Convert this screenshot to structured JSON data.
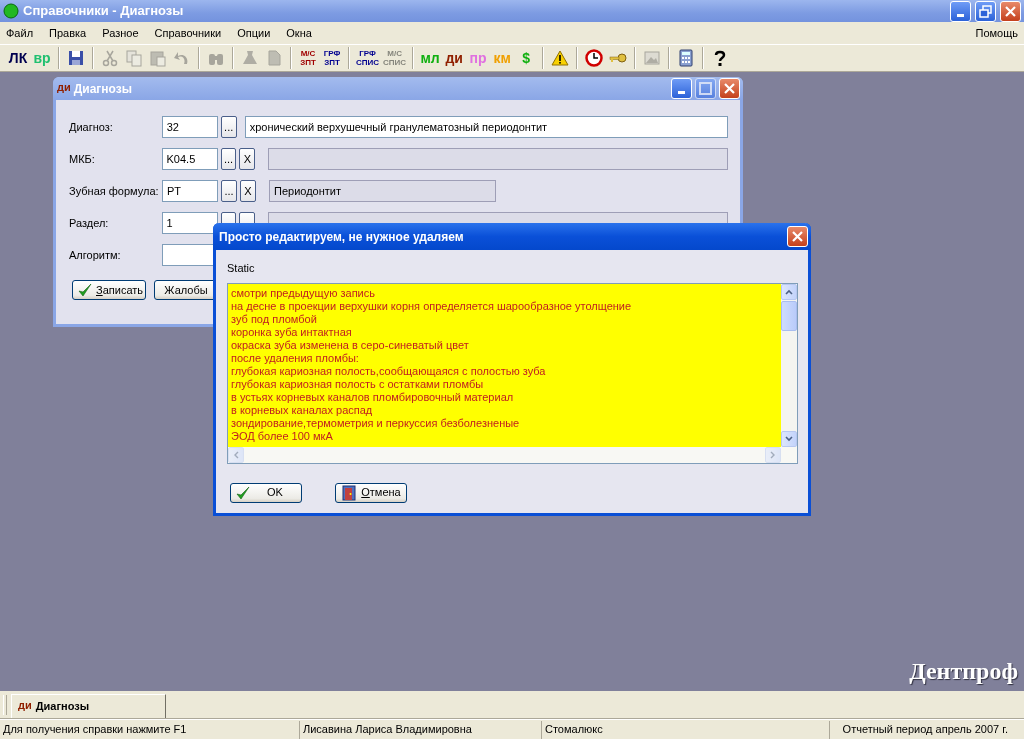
{
  "window": {
    "title": "Справочники - Диагнозы"
  },
  "menu": [
    "Файл",
    "Правка",
    "Разное",
    "Справочники",
    "Опции",
    "Окна"
  ],
  "help_menu": "Помощь",
  "toolbar": [
    {
      "kind": "text",
      "lines": [
        "ЛК"
      ],
      "color": "#000050",
      "disabled": false
    },
    {
      "kind": "text",
      "lines": [
        "вр"
      ],
      "color": "#20c070",
      "disabled": false
    },
    {
      "kind": "separator"
    },
    {
      "kind": "icon",
      "disabled": false
    },
    {
      "kind": "separator"
    },
    {
      "kind": "icon",
      "disabled": true
    },
    {
      "kind": "icon",
      "disabled": true
    },
    {
      "kind": "icon",
      "disabled": true
    },
    {
      "kind": "icon",
      "disabled": true
    },
    {
      "kind": "separator"
    },
    {
      "kind": "icon",
      "disabled": true
    },
    {
      "kind": "separator"
    },
    {
      "kind": "icon",
      "disabled": true
    },
    {
      "kind": "icon",
      "disabled": true
    },
    {
      "kind": "separator"
    },
    {
      "kind": "text",
      "lines": [
        "М/С",
        "ЗПТ"
      ],
      "color": "#a00000",
      "disabled": false
    },
    {
      "kind": "text",
      "lines": [
        "ГРФ",
        "ЗПТ"
      ],
      "color": "#000090",
      "disabled": false
    },
    {
      "kind": "separator"
    },
    {
      "kind": "text",
      "lines": [
        "ГРФ",
        "СПИС"
      ],
      "color": "#000090",
      "disabled": false
    },
    {
      "kind": "text",
      "lines": [
        "М/С",
        "СПИС"
      ],
      "disabled": true
    },
    {
      "kind": "separator"
    },
    {
      "kind": "text",
      "lines": [
        "мл"
      ],
      "color": "#10b010",
      "disabled": false
    },
    {
      "kind": "text",
      "lines": [
        "ди"
      ],
      "color": "#902000",
      "disabled": false
    },
    {
      "kind": "text",
      "lines": [
        "пр"
      ],
      "color": "#e070e0",
      "disabled": false
    },
    {
      "kind": "text",
      "lines": [
        "км"
      ],
      "color": "#f0a000",
      "disabled": false
    },
    {
      "kind": "text",
      "lines": [
        "$"
      ],
      "color": "#10b010",
      "disabled": false
    },
    {
      "kind": "separator"
    },
    {
      "kind": "icon",
      "disabled": false
    },
    {
      "kind": "separator"
    },
    {
      "kind": "icon",
      "disabled": false
    },
    {
      "kind": "icon",
      "disabled": false
    },
    {
      "kind": "separator"
    },
    {
      "kind": "icon",
      "disabled": true
    },
    {
      "kind": "separator"
    },
    {
      "kind": "icon",
      "disabled": false
    },
    {
      "kind": "separator"
    },
    {
      "kind": "icon",
      "disabled": false
    }
  ],
  "child_window": {
    "badge": "ди",
    "title": "Диагнозы",
    "fields": [
      {
        "kind": "code",
        "label": "Диагноз:",
        "code": "32",
        "browse": "...",
        "description": "хронический верхушечный гранулематозный периодонтит",
        "editable": true,
        "wide": true
      },
      {
        "kind": "code",
        "label": "МКБ:",
        "code": "K04.5",
        "browse": "...",
        "clear": "X",
        "editable": false,
        "wide": true
      },
      {
        "kind": "code",
        "label": "Зубная формула:",
        "code": "PT",
        "browse": "...",
        "clear": "X",
        "description": "Периодонтит",
        "editable": false,
        "wide": false
      },
      {
        "kind": "covered",
        "label": "Раздел:",
        "code": "1"
      },
      {
        "kind": "text",
        "label": "Алгоритм:"
      }
    ],
    "buttons": [
      {
        "kind": "confirm",
        "label": "Записать",
        "mnemonic": true
      },
      {
        "kind": "plain",
        "label": "Жалобы",
        "mnemonic": false
      }
    ]
  },
  "dialog": {
    "title": "Просто редактируем, не нужное удаляем",
    "label": "Static",
    "lines": [
      "смотри предыдущую запись",
      "на десне в проекции верхушки корня определяется шарообразное утолщение",
      "зуб под пломбой",
      "коронка зуба интактная",
      "окраска зуба изменена в серо-синеватый цвет",
      "после удаления пломбы:",
      "глубокая кариозная полость,сообщающаяся с полостью зуба",
      "глубокая кариозная полость с остатками пломбы",
      "в устьях корневых каналов пломбировочный материал",
      "в корневых каналах распад",
      "зондирование,термометрия и перкуссия безболезненые",
      "ЭОД более 100 мкА"
    ],
    "buttons": [
      {
        "kind": "confirm",
        "label": "OK",
        "mnemonic": false
      },
      {
        "kind": "cancel",
        "label": "Отмена",
        "mnemonic": true
      }
    ]
  },
  "logo": "Дентпроф",
  "window_tabs": [
    {
      "badge": "ди",
      "title": "Диагнозы",
      "selected": true
    }
  ],
  "status_bar": [
    "Для получения справки нажмите F1",
    "Лисавина Лариса Владимировна",
    "Стомалюкс",
    "Отчетный период апрель 2007 г."
  ]
}
